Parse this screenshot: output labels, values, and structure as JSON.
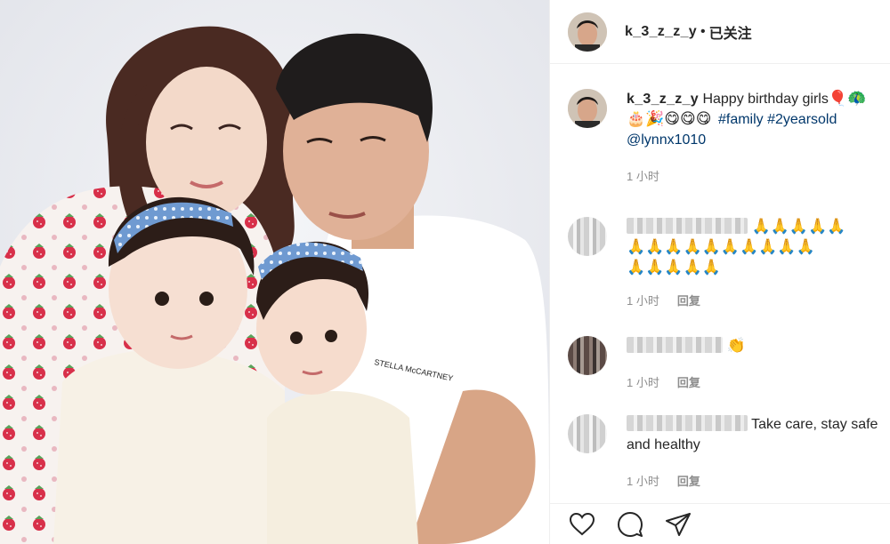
{
  "post": {
    "author": "k_3_z_z_y",
    "separator": "•",
    "follow_status": "已关注"
  },
  "caption": {
    "username": "k_3_z_z_y",
    "text": "Happy birthday girls",
    "emojis_line1": "🎈🦚",
    "emojis_line2": "🎂🎉😋😋😋",
    "hashtag_1": "#family",
    "hashtag_2": "#2yearsold",
    "mention": "@lynnx1010",
    "time": "1 小时"
  },
  "comments": [
    {
      "text": "🙏🙏🙏🙏🙏🙏🙏🙏🙏🙏🙏🙏🙏🙏🙏🙏🙏🙏🙏🙏",
      "time": "1 小时",
      "reply": "回复"
    },
    {
      "text": "👏",
      "time": "1 小时",
      "reply": "回复"
    },
    {
      "text": "Take care, stay safe and healthy",
      "time": "1 小时",
      "reply": "回复"
    }
  ],
  "comment_1_lines": [
    "🙏🙏🙏🙏🙏",
    "🙏🙏🙏🙏🙏🙏🙏🙏🙏🙏",
    "🙏🙏🙏🙏🙏"
  ],
  "actions": {
    "like_icon": "heart-icon",
    "comment_icon": "speech-bubble-icon",
    "share_icon": "paper-plane-icon"
  },
  "colors": {
    "hashtag": "#00376b",
    "meta": "#8e8e8e",
    "text": "#262626",
    "divider": "#efefef"
  }
}
